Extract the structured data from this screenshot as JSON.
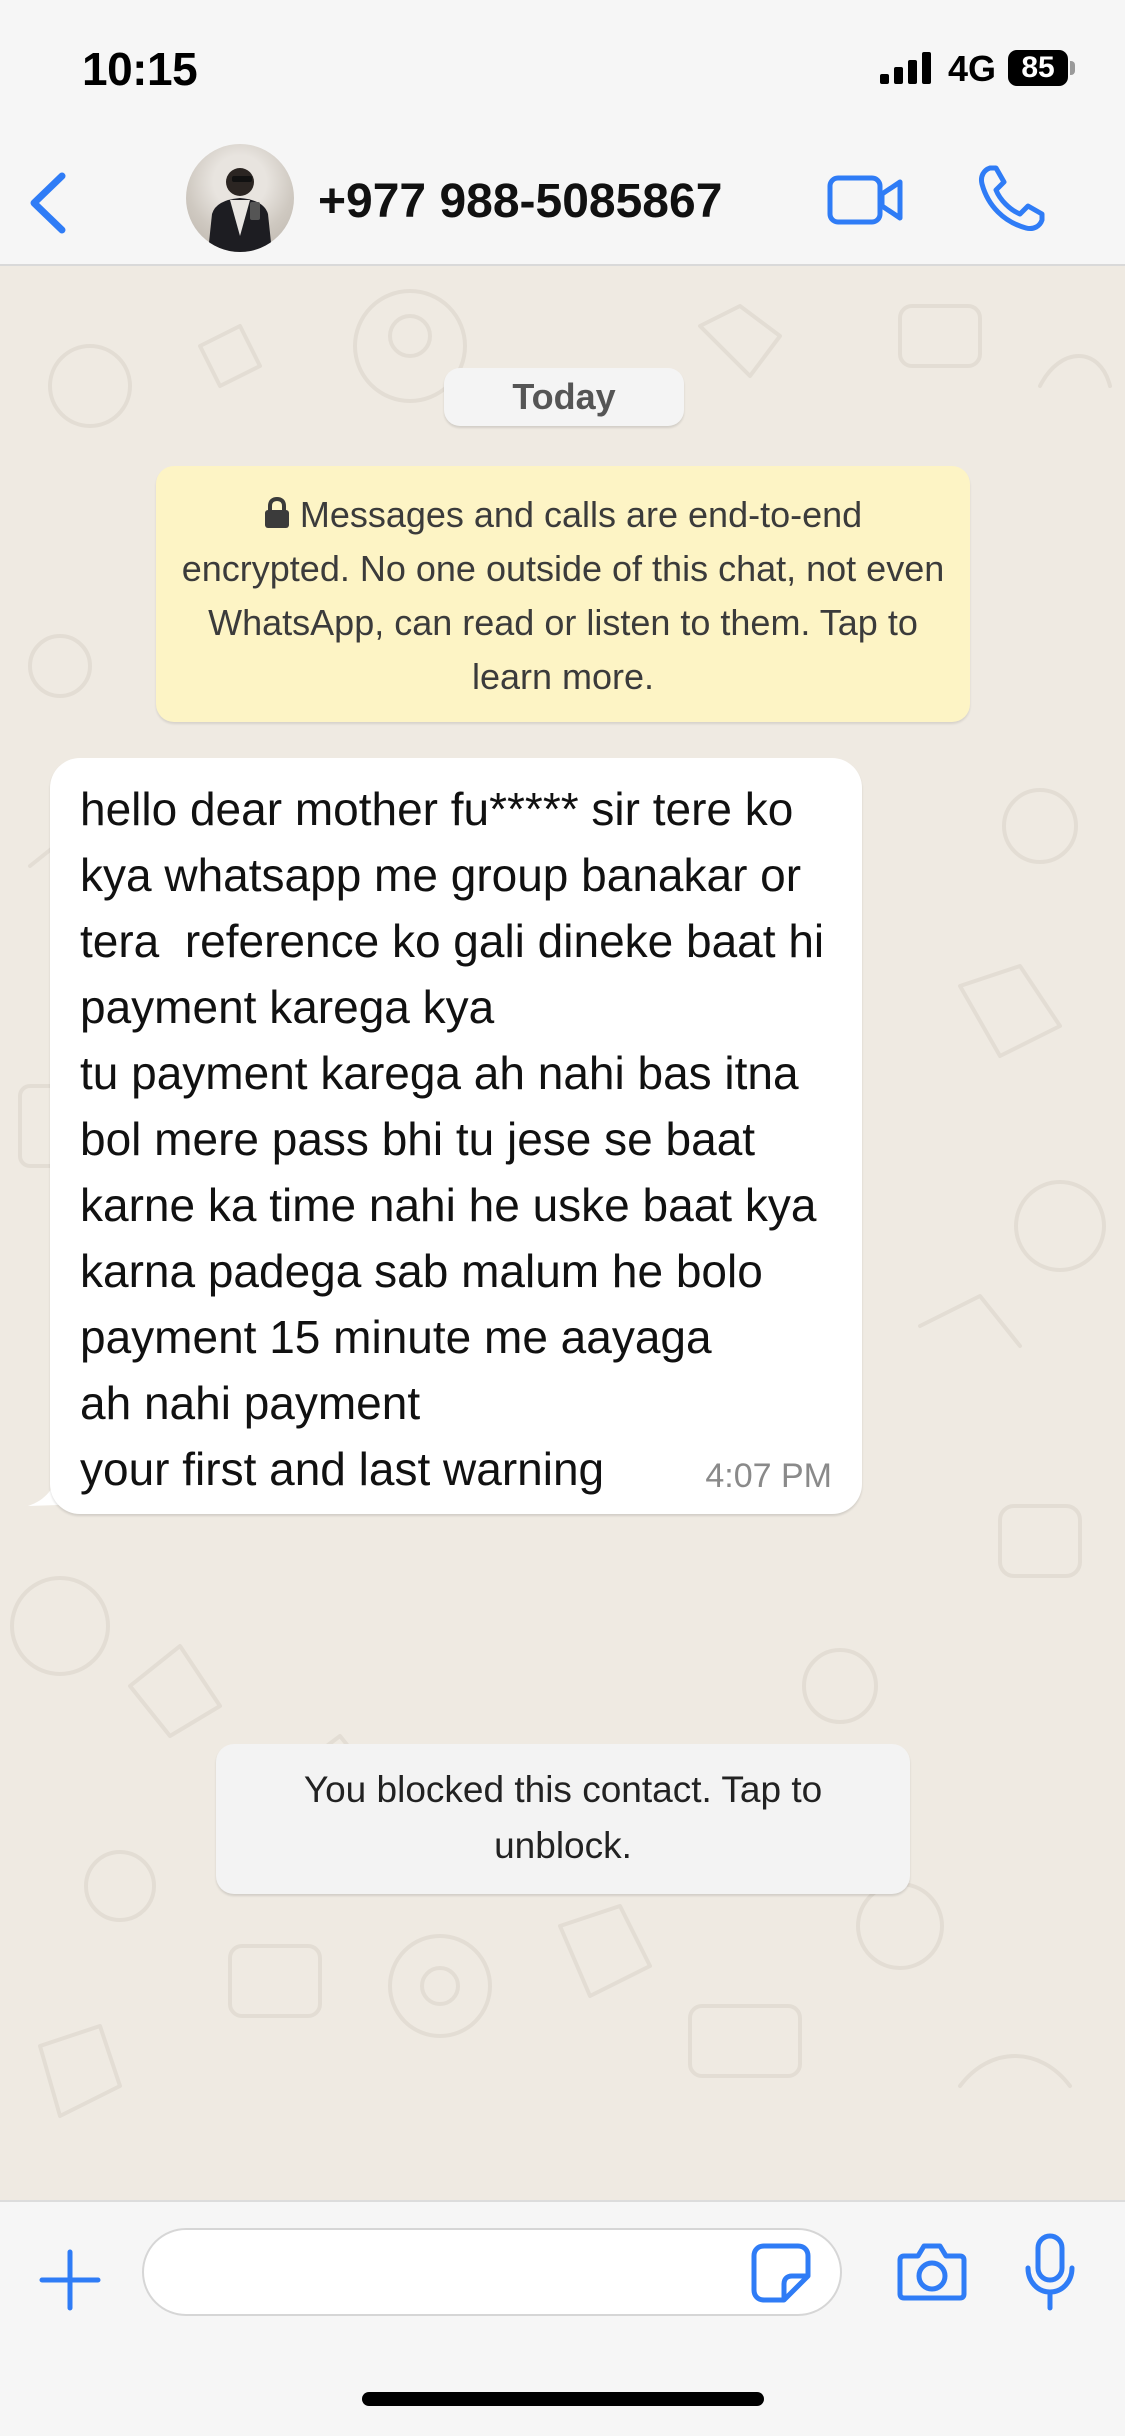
{
  "status_bar": {
    "time": "10:15",
    "network": "4G",
    "battery": "85",
    "icons": [
      "signal-icon",
      "battery-icon"
    ]
  },
  "header": {
    "contact_name": "+977 988-5085867",
    "icons": [
      "chevron-left-icon",
      "video-camera-icon",
      "phone-icon"
    ],
    "accent_color": "#2f7cf6"
  },
  "chat": {
    "date_label": "Today",
    "encryption_notice": "Messages and calls are end-to-end encrypted. No one outside of this chat, not even WhatsApp, can read or listen to them. Tap to learn more.",
    "messages": [
      {
        "direction": "incoming",
        "text": "hello dear mother fu***** sir tere ko kya whatsapp me group banakar or\ntera  reference ko gali dineke baat hi payment karega kya\ntu payment karega ah nahi bas itna bol mere pass bhi tu jese se baat karne ka time nahi he uske baat kya karna padega sab malum he bolo\npayment 15 minute me aayaga\nah nahi payment\nyour first and last warning",
        "time": "4:07 PM"
      }
    ],
    "blocked_notice": "You blocked this contact. Tap to unblock.",
    "notice_color": "#fdf4c5",
    "wallpaper_color": "#efeae2"
  },
  "input_bar": {
    "placeholder": "",
    "icons": [
      "plus-icon",
      "sticker-icon",
      "camera-icon",
      "microphone-icon"
    ]
  }
}
